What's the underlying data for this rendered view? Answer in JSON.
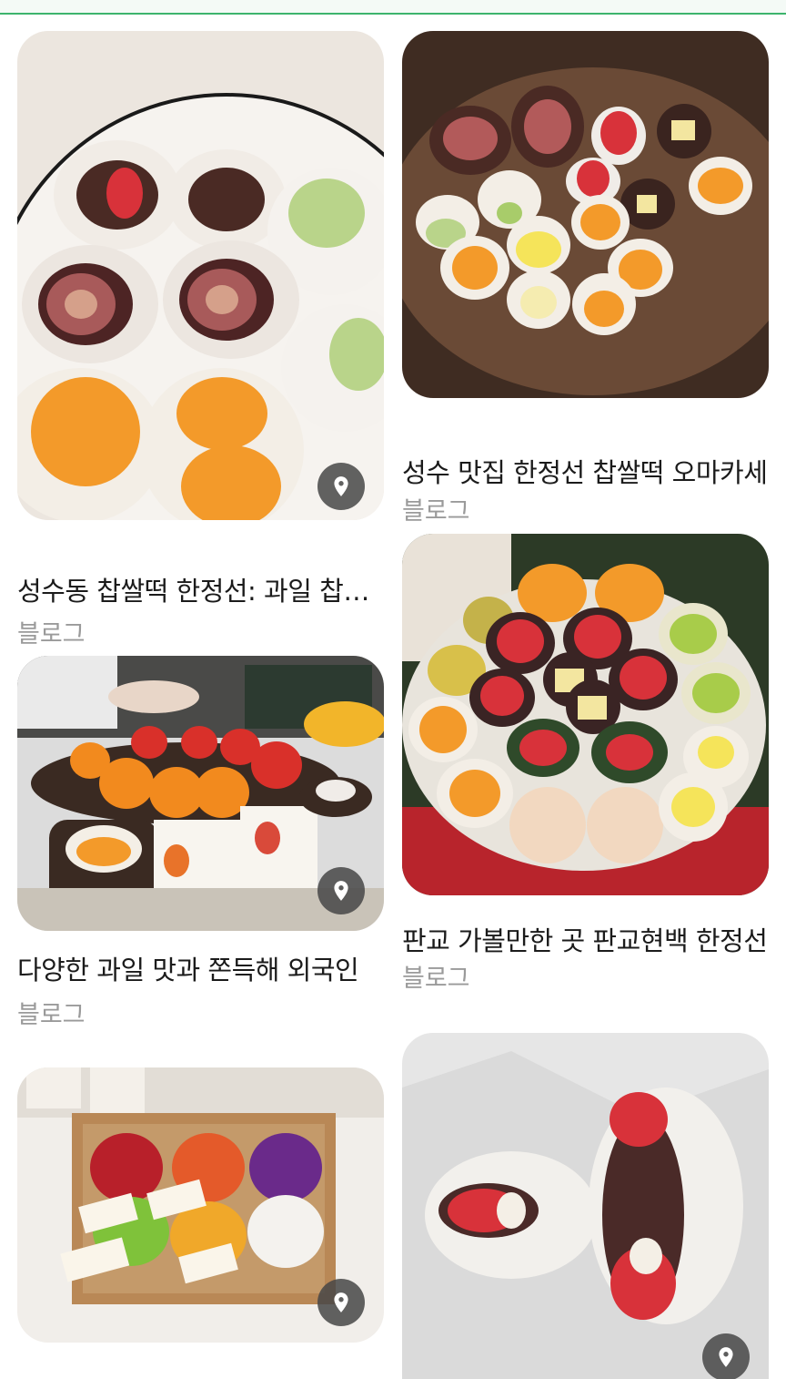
{
  "results": [
    {
      "title": "성수동 찹쌀떡 한정선: 과일 찹쌀떡",
      "source": "블로그",
      "location_pin": "location-pin-icon"
    },
    {
      "title": "성수 맛집 한정선 찹쌀떡 오마카세",
      "source": "블로그"
    },
    {
      "title": "다양한 과일 맛과 쫀득해 외국인",
      "source": "블로그",
      "location_pin": "location-pin-icon"
    },
    {
      "title": "판교 가볼만한 곳 판교현백 한정선",
      "source": "블로그"
    },
    {
      "location_pin": "location-pin-icon"
    },
    {
      "location_pin": "location-pin-icon"
    }
  ],
  "colors": {
    "accent_line": "#3db46d",
    "title_text": "#1b1b1b",
    "source_text": "#9a9a9a"
  }
}
